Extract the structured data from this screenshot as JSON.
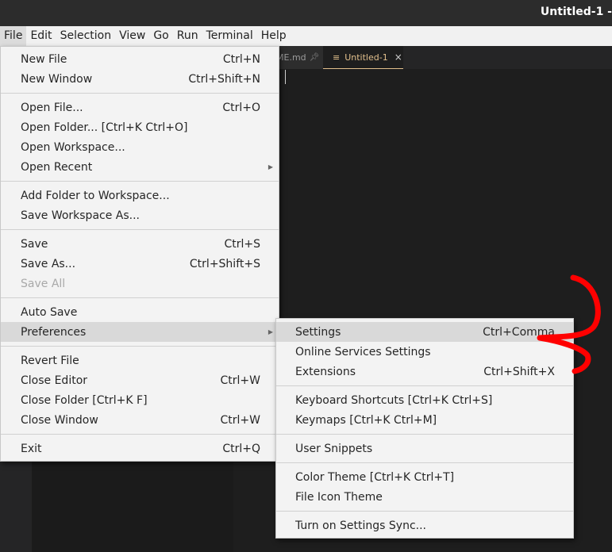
{
  "window": {
    "title": "Untitled-1 -"
  },
  "menubar": {
    "items": [
      "File",
      "Edit",
      "Selection",
      "View",
      "Go",
      "Run",
      "Terminal",
      "Help"
    ]
  },
  "tabs": [
    {
      "label": "ME.md",
      "icon": "pin-icon"
    },
    {
      "label": "Untitled-1",
      "icon": "file-lines-icon",
      "close": "×",
      "active": true
    }
  ],
  "colors": {
    "accent": "#e2c08d",
    "annotation": "#ff0000"
  },
  "file_menu": {
    "new_file": "New File",
    "new_file_sc": "Ctrl+N",
    "new_window": "New Window",
    "new_window_sc": "Ctrl+Shift+N",
    "open_file": "Open File...",
    "open_file_sc": "Ctrl+O",
    "open_folder": "Open Folder... [Ctrl+K Ctrl+O]",
    "open_workspace": "Open Workspace...",
    "open_recent": "Open Recent",
    "add_folder": "Add Folder to Workspace...",
    "save_workspace_as": "Save Workspace As...",
    "save": "Save",
    "save_sc": "Ctrl+S",
    "save_as": "Save As...",
    "save_as_sc": "Ctrl+Shift+S",
    "save_all": "Save All",
    "auto_save": "Auto Save",
    "preferences": "Preferences",
    "revert_file": "Revert File",
    "close_editor": "Close Editor",
    "close_editor_sc": "Ctrl+W",
    "close_folder": "Close Folder [Ctrl+K F]",
    "close_window": "Close Window",
    "close_window_sc": "Ctrl+W",
    "exit": "Exit",
    "exit_sc": "Ctrl+Q"
  },
  "preferences_menu": {
    "settings": "Settings",
    "settings_sc": "Ctrl+Comma",
    "online_services": "Online Services Settings",
    "extensions": "Extensions",
    "extensions_sc": "Ctrl+Shift+X",
    "keyboard_shortcuts": "Keyboard Shortcuts [Ctrl+K Ctrl+S]",
    "keymaps": "Keymaps [Ctrl+K Ctrl+M]",
    "user_snippets": "User Snippets",
    "color_theme": "Color Theme [Ctrl+K Ctrl+T]",
    "file_icon_theme": "File Icon Theme",
    "settings_sync": "Turn on Settings Sync..."
  }
}
